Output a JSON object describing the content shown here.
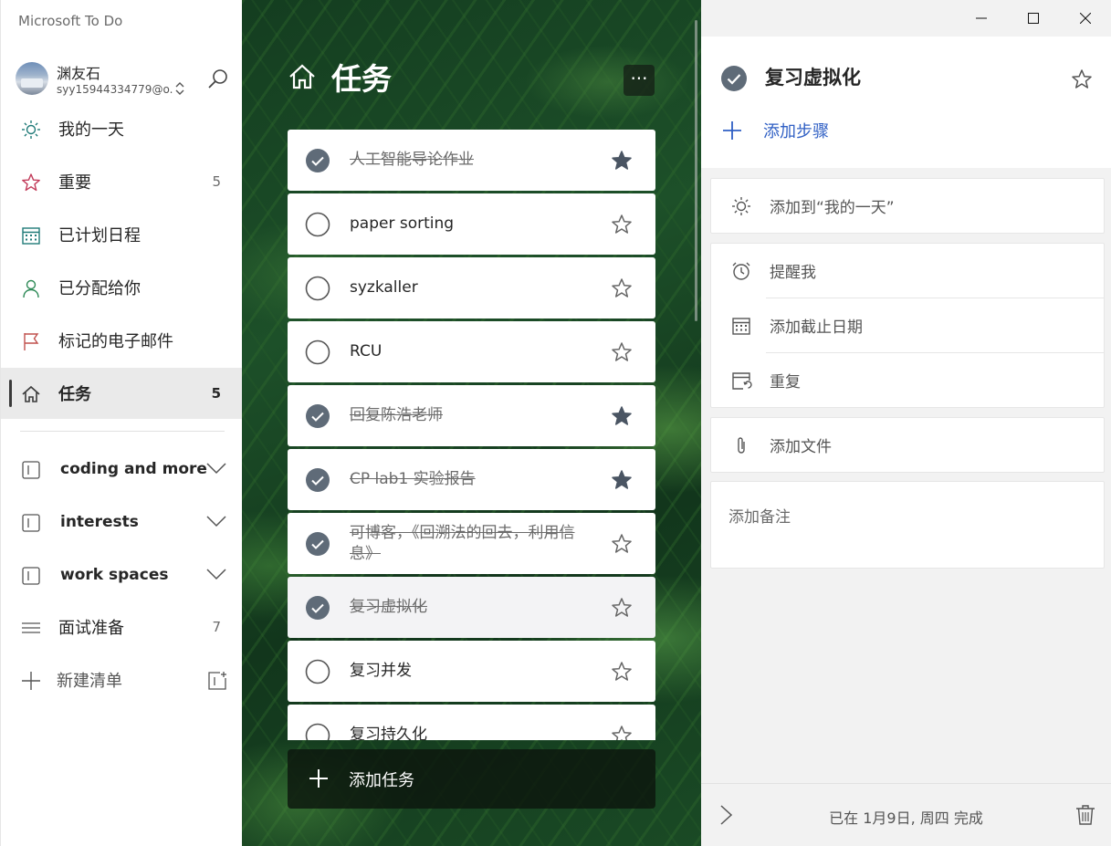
{
  "app": {
    "title": "Microsoft To Do"
  },
  "profile": {
    "name": "渊友石",
    "email": "syy15944334779@o..."
  },
  "sidebar": {
    "items": [
      {
        "label": "我的一天",
        "count": "",
        "icon": "sun-icon"
      },
      {
        "label": "重要",
        "count": "5",
        "icon": "star-icon"
      },
      {
        "label": "已计划日程",
        "count": "",
        "icon": "calendar-icon"
      },
      {
        "label": "已分配给你",
        "count": "",
        "icon": "person-icon"
      },
      {
        "label": "标记的电子邮件",
        "count": "",
        "icon": "flag-icon"
      },
      {
        "label": "任务",
        "count": "5",
        "icon": "home-icon",
        "active": true
      }
    ],
    "groups": [
      {
        "label": "coding and more"
      },
      {
        "label": "interests"
      },
      {
        "label": "work spaces"
      }
    ],
    "lists": [
      {
        "label": "面试准备",
        "count": "7"
      }
    ],
    "new_list": "新建清单"
  },
  "main": {
    "title": "任务",
    "more": "···",
    "tasks": [
      {
        "title": "人工智能导论作业",
        "done": true,
        "important": true
      },
      {
        "title": "paper sorting",
        "done": false,
        "important": false
      },
      {
        "title": "syzkaller",
        "done": false,
        "important": false
      },
      {
        "title": "RCU",
        "done": false,
        "important": false
      },
      {
        "title": "回复陈浩老师",
        "done": true,
        "important": true
      },
      {
        "title": "CP lab1 实验报告",
        "done": true,
        "important": true
      },
      {
        "title": "可博客，《回溯法的回去，利用信息》",
        "done": true,
        "important": false
      },
      {
        "title": "复习虚拟化",
        "done": true,
        "important": false,
        "selected": true
      },
      {
        "title": "复习并发",
        "done": false,
        "important": false
      },
      {
        "title": "复习持久化",
        "done": false,
        "important": false
      }
    ],
    "add_task": "添加任务"
  },
  "detail": {
    "title": "复习虚拟化",
    "add_step": "添加步骤",
    "my_day": "添加到“我的一天”",
    "remind": "提醒我",
    "due_date": "添加截止日期",
    "repeat": "重复",
    "add_file": "添加文件",
    "note_placeholder": "添加备注",
    "footer": "已在 1月9日, 周四 完成"
  },
  "colors": {
    "accent_blue": "#2f5fc4",
    "check_gray": "#5f6b78",
    "important_red": "#c23b5a",
    "planned_teal": "#1f7a78",
    "assigned_green": "#2e8a57",
    "flag_red": "#c0504d"
  }
}
